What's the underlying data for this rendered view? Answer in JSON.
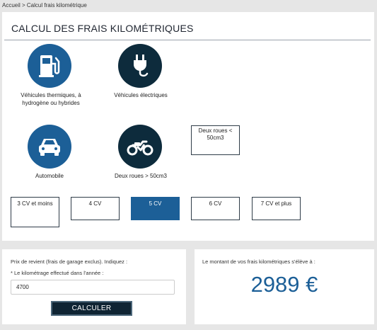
{
  "breadcrumb": "Accueil > Calcul frais kilométrique",
  "title": "CALCUL DES FRAIS KILOMÉTRIQUES",
  "categories": {
    "thermique": "Véhicules thermiques, à hydrogène ou hybrides",
    "electrique": "Véhicules électriques",
    "automobile": "Automobile",
    "deux_roues_plus": "Deux roues > 50cm3",
    "deux_roues_moins": "Deux roues < 50cm3"
  },
  "power_options": [
    "3 CV et moins",
    "4 CV",
    "5 CV",
    "6 CV",
    "7 CV et plus"
  ],
  "selected_power": "5 CV",
  "form": {
    "intro": "Prix de revient (frais de garage exclus). Indiquez :",
    "km_label": "* Le kilométrage effectué dans l'année :",
    "km_value": "4700",
    "submit": "CALCULER"
  },
  "result": {
    "label": "Le montant de vos frais kilométriques s'élève à :",
    "value": "2989 €"
  },
  "colors": {
    "accent": "#1c5f97",
    "dark": "#0d2b3c",
    "button": "#0f2433"
  },
  "icons": [
    "fuel-pump-icon",
    "electric-plug-icon",
    "car-icon",
    "motorcycle-icon"
  ]
}
